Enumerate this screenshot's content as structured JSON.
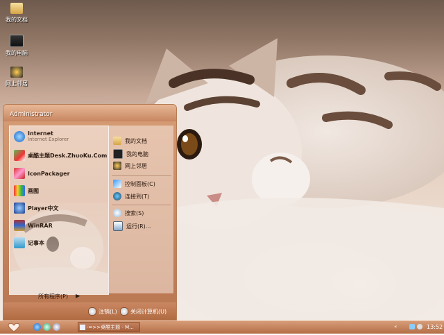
{
  "desktop": {
    "icons": [
      {
        "label": "我的文档",
        "icon": "my-documents-icon"
      },
      {
        "label": "我的电脑",
        "icon": "my-computer-icon"
      },
      {
        "label": "网上邻居",
        "icon": "network-places-icon"
      }
    ]
  },
  "start_menu": {
    "user": "Administrator",
    "pinned": [
      {
        "title": "Internet",
        "subtitle": "Internet Explorer",
        "icon": "internet-explorer-icon"
      },
      {
        "title": "桌酷主题Desk.ZhuoKu.Com",
        "icon": "zhuoku-theme-icon"
      }
    ],
    "recent": [
      {
        "label": "IconPackager",
        "icon": "iconpackager-icon"
      },
      {
        "label": "画图",
        "icon": "paint-icon"
      },
      {
        "label": "Player中文",
        "icon": "media-player-icon"
      },
      {
        "label": "WinRAR",
        "icon": "winrar-icon"
      },
      {
        "label": "记事本",
        "icon": "notepad-icon"
      }
    ],
    "all_programs": "所有程序(P)",
    "right": [
      {
        "label": "我的文档",
        "icon": "my-documents-icon"
      },
      {
        "label": "我的电脑",
        "icon": "my-computer-icon"
      },
      {
        "label": "网上邻居",
        "icon": "network-places-icon"
      },
      {
        "label": "控制面板(C)",
        "icon": "control-panel-icon"
      },
      {
        "label": "连接到(T)",
        "icon": "connect-to-icon"
      },
      {
        "label": "搜索(S)",
        "icon": "search-icon"
      },
      {
        "label": "运行(R)...",
        "icon": "run-icon"
      }
    ],
    "logoff": "注销(L)",
    "shutdown": "关闭计算机(U)"
  },
  "taskbar": {
    "task_label": "-=>>桌酷主题 - M...",
    "clock": "13:52"
  }
}
